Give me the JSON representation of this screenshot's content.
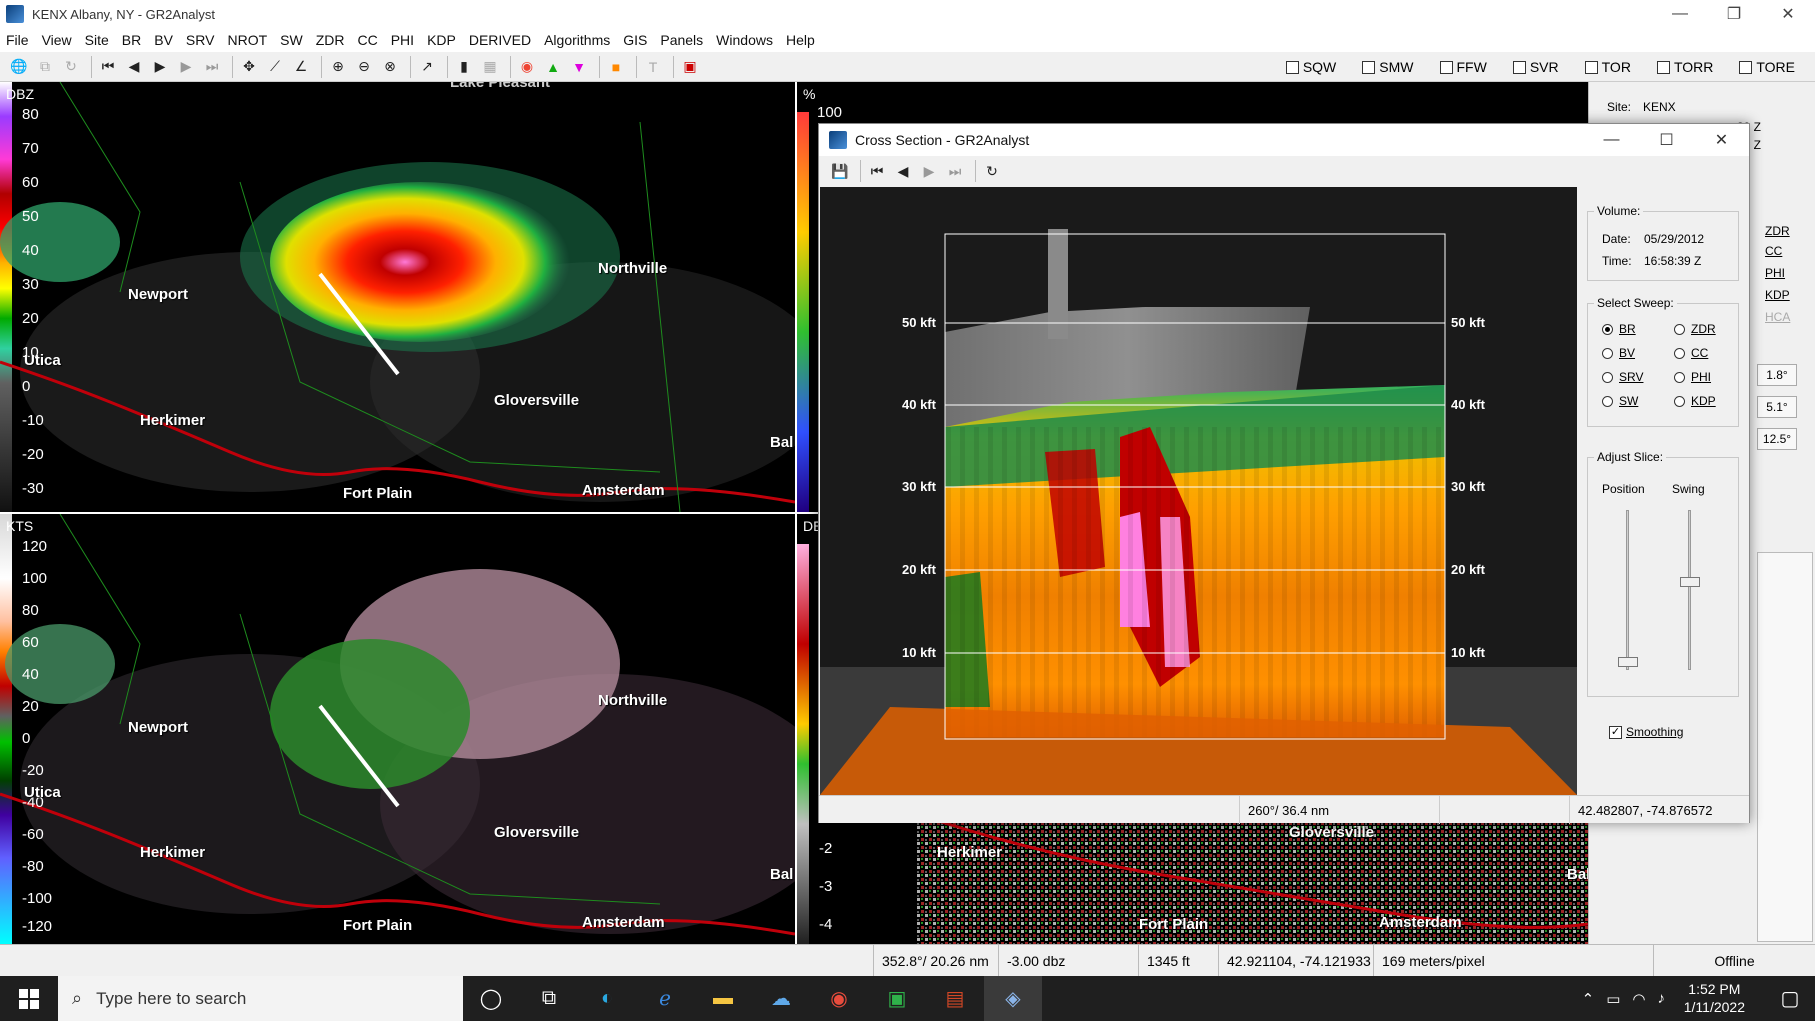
{
  "window": {
    "title": "KENX Albany, NY - GR2Analyst",
    "minimize": "—",
    "maximize": "❐",
    "close": "✕"
  },
  "menu": [
    "File",
    "View",
    "Site",
    "BR",
    "BV",
    "SRV",
    "NROT",
    "SW",
    "ZDR",
    "CC",
    "PHI",
    "KDP",
    "DERIVED",
    "Algorithms",
    "GIS",
    "Panels",
    "Windows",
    "Help"
  ],
  "warnings": [
    {
      "label": "SQW"
    },
    {
      "label": "SMW"
    },
    {
      "label": "FFW"
    },
    {
      "label": "SVR"
    },
    {
      "label": "TOR"
    },
    {
      "label": "TORR"
    },
    {
      "label": "TORE"
    }
  ],
  "panes": {
    "reflectivity": {
      "unit": "DBZ",
      "scale": [
        "80",
        "70",
        "60",
        "50",
        "40",
        "30",
        "20",
        "10",
        "0",
        "-10",
        "-20",
        "-30"
      ]
    },
    "velocity": {
      "unit": "KTS",
      "scale": [
        "120",
        "100",
        "80",
        "60",
        "40",
        "20",
        "0",
        "-20",
        "-40",
        "-60",
        "-80",
        "-100",
        "-120"
      ]
    },
    "top_right": {
      "unit": "%",
      "scale": [
        "100"
      ]
    },
    "bottom_right": {
      "unit": "DE",
      "scale": [
        "-2",
        "-3",
        "-4"
      ]
    }
  },
  "cities": {
    "newport": "Newport",
    "northville": "Northville",
    "utica": "Utica",
    "herkimer": "Herkimer",
    "gloversville": "Gloversville",
    "fort_plain": "Fort Plain",
    "amsterdam": "Amsterdam",
    "ballston": "Bal",
    "lake_pleasant": "Lake Pleasant"
  },
  "right_strip": {
    "site_label": "Site:",
    "site_value": "KENX",
    "time1": "39 Z",
    "time2": "36 Z",
    "products": [
      "ZDR",
      "CC",
      "PHI",
      "KDP",
      "HCA"
    ],
    "tilts": [
      "1.8°",
      "5.1°",
      "12.5°"
    ]
  },
  "cross_section": {
    "title": "Cross Section - GR2Analyst",
    "heights": [
      "50 kft",
      "40 kft",
      "30 kft",
      "20 kft",
      "10 kft"
    ],
    "volume": {
      "group_title": "Volume:",
      "date_label": "Date:",
      "date": "05/29/2012",
      "time_label": "Time:",
      "time": "16:58:39 Z"
    },
    "sweep": {
      "group_title": "Select Sweep:",
      "options": [
        {
          "label": "BR",
          "selected": true
        },
        {
          "label": "ZDR",
          "selected": false
        },
        {
          "label": "BV",
          "selected": false
        },
        {
          "label": "CC",
          "selected": false
        },
        {
          "label": "SRV",
          "selected": false
        },
        {
          "label": "PHI",
          "selected": false
        },
        {
          "label": "SW",
          "selected": false
        },
        {
          "label": "KDP",
          "selected": false
        }
      ]
    },
    "slice": {
      "group_title": "Adjust Slice:",
      "position_label": "Position",
      "swing_label": "Swing",
      "position_value": 0.05,
      "swing_value": 0.55
    },
    "smoothing": {
      "label": "Smoothing",
      "checked": true
    },
    "status": {
      "azimuth_range": "260°/ 36.4 nm",
      "latlon": "42.482807, -74.876572"
    }
  },
  "statusbar": {
    "azimuth_range": "352.8°/ 20.26 nm",
    "value": "-3.00 dbz",
    "height": "1345 ft",
    "latlon": "42.921104, -74.121933",
    "resolution": "169 meters/pixel",
    "mode": "Offline"
  },
  "taskbar": {
    "search_placeholder": "Type here to search",
    "time": "1:52 PM",
    "date": "1/11/2022"
  },
  "colors": {
    "accent": "#1f1f1f",
    "road": "#c0000a",
    "county_line": "#1e8c1e"
  }
}
